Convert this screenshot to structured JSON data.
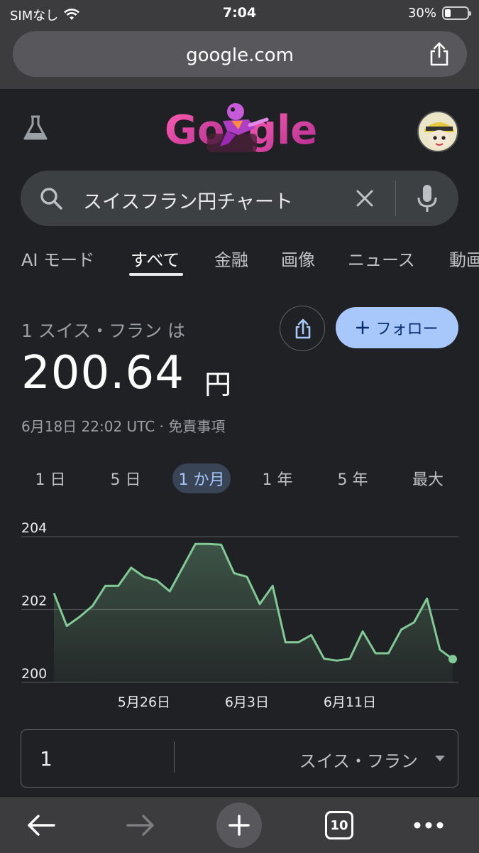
{
  "status": {
    "carrier": "SIMなし",
    "time": "7:04",
    "battery": "30%"
  },
  "browser": {
    "url": "google.com",
    "tabs_count": "10"
  },
  "search": {
    "query": "スイスフラン円チャート"
  },
  "tabs": [
    {
      "label": "AI モード"
    },
    {
      "label": "すべて"
    },
    {
      "label": "金融"
    },
    {
      "label": "画像"
    },
    {
      "label": "ニュース"
    },
    {
      "label": "動画"
    }
  ],
  "conversion": {
    "from_text": "1 スイス・フラン は",
    "value": "200.64",
    "unit": "円",
    "timestamp": "6月18日 22:02 UTC",
    "disclaimer": "免責事項",
    "follow_label": "フォロー"
  },
  "ranges": [
    {
      "label": "1 日"
    },
    {
      "label": "5 日"
    },
    {
      "label": "1 か月"
    },
    {
      "label": "1 年"
    },
    {
      "label": "5 年"
    },
    {
      "label": "最大"
    }
  ],
  "converter": {
    "amount": "1",
    "currency": "スイス・フラン"
  },
  "colors": {
    "line": "#81c995",
    "accent": "#a8c7fa",
    "background": "#202124"
  },
  "chart_data": {
    "type": "area",
    "ylim": [
      200,
      204
    ],
    "y_ticks": [
      "200",
      "202",
      "204"
    ],
    "x_ticks": [
      {
        "label": "5月26日",
        "index": 7
      },
      {
        "label": "6月3日",
        "index": 15
      },
      {
        "label": "6月11日",
        "index": 23
      }
    ],
    "values": [
      202.45,
      201.55,
      201.8,
      202.1,
      202.65,
      202.65,
      203.15,
      202.9,
      202.8,
      202.5,
      203.15,
      203.8,
      203.8,
      203.78,
      203.0,
      202.9,
      202.15,
      202.65,
      201.1,
      201.1,
      201.3,
      200.65,
      200.6,
      200.65,
      201.4,
      200.8,
      200.8,
      201.45,
      201.65,
      202.3,
      200.9,
      200.64
    ]
  }
}
